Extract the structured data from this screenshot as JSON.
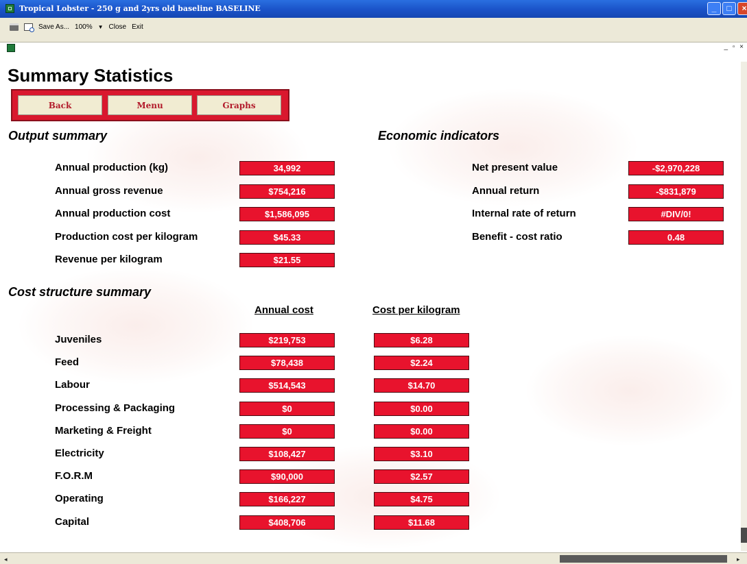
{
  "window": {
    "title": "Tropical Lobster - 250 g and 2yrs old baseline BASELINE",
    "minimize_glyph": "_",
    "maximize_glyph": "□",
    "close_glyph": "×"
  },
  "toolbar": {
    "save_as_label": "Save As...",
    "zoom_value": "100%",
    "zoom_dropdown_glyph": "▼",
    "close_label": "Close",
    "exit_label": "Exit"
  },
  "mdi_controls": "_ ▫ ×",
  "page": {
    "title": "Summary Statistics"
  },
  "nav": {
    "back_label": "Back",
    "menu_label": "Menu",
    "graphs_label": "Graphs"
  },
  "output_summary": {
    "title": "Output summary",
    "rows": [
      {
        "label": "Annual production (kg)",
        "value": "34,992"
      },
      {
        "label": "Annual gross revenue",
        "value": "$754,216"
      },
      {
        "label": "Annual production cost",
        "value": "$1,586,095"
      },
      {
        "label": "Production cost per kilogram",
        "value": "$45.33"
      },
      {
        "label": "Revenue per kilogram",
        "value": "$21.55"
      }
    ]
  },
  "economic_indicators": {
    "title": "Economic indicators",
    "rows": [
      {
        "label": "Net present value",
        "value": "-$2,970,228"
      },
      {
        "label": "Annual return",
        "value": "-$831,879"
      },
      {
        "label": "Internal rate of return",
        "value": "#DIV/0!"
      },
      {
        "label": "Benefit - cost ratio",
        "value": "0.48"
      }
    ]
  },
  "cost_structure": {
    "title": "Cost structure summary",
    "col_annual": "Annual cost",
    "col_per_kg": "Cost per kilogram",
    "rows": [
      {
        "label": "Juveniles",
        "annual": "$219,753",
        "per_kg": "$6.28"
      },
      {
        "label": "Feed",
        "annual": "$78,438",
        "per_kg": "$2.24"
      },
      {
        "label": "Labour",
        "annual": "$514,543",
        "per_kg": "$14.70"
      },
      {
        "label": "Processing & Packaging",
        "annual": "$0",
        "per_kg": "$0.00"
      },
      {
        "label": "Marketing & Freight",
        "annual": "$0",
        "per_kg": "$0.00"
      },
      {
        "label": "Electricity",
        "annual": "$108,427",
        "per_kg": "$3.10"
      },
      {
        "label": "F.O.R.M",
        "annual": "$90,000",
        "per_kg": "$2.57"
      },
      {
        "label": "Operating",
        "annual": "$166,227",
        "per_kg": "$4.75"
      },
      {
        "label": "Capital",
        "annual": "$408,706",
        "per_kg": "$11.68"
      }
    ]
  },
  "icons": {
    "app": "excel-app-icon",
    "print": "printer-icon",
    "preview": "print-preview-icon"
  },
  "colors": {
    "value_box": "#e8132d",
    "nav_frame": "#d9182e",
    "nav_button_text": "#b21a2a",
    "titlebar": "#1a52c8"
  }
}
